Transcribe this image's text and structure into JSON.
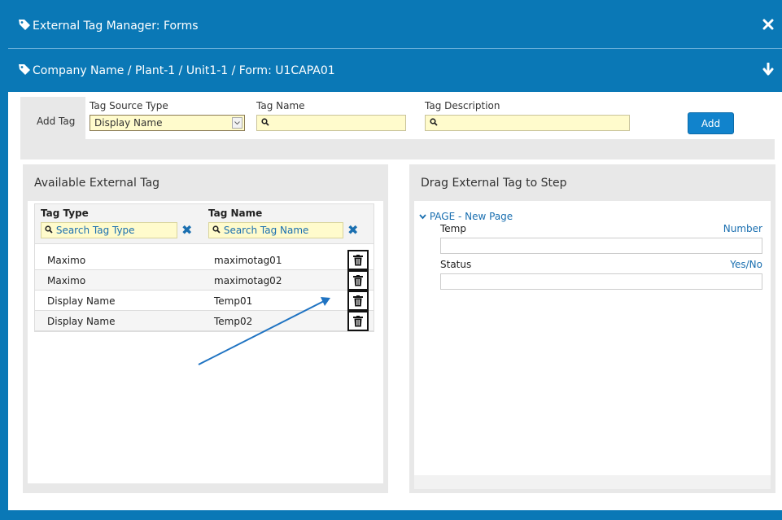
{
  "window": {
    "title": "External Tag Manager: Forms",
    "breadcrumb": "Company Name / Plant-1 / Unit1-1 / Form: U1CAPA01"
  },
  "add_tag": {
    "label": "Add Tag",
    "source_type_label": "Tag Source Type",
    "source_type_value": "Display Name",
    "tag_name_label": "Tag Name",
    "tag_name_value": "",
    "tag_description_label": "Tag Description",
    "tag_description_value": "",
    "add_button": "Add"
  },
  "available": {
    "title": "Available External Tag",
    "columns": [
      "Tag Type",
      "Tag Name"
    ],
    "filter_tag_type_placeholder": "Search Tag Type",
    "filter_tag_name_placeholder": "Search Tag Name",
    "rows": [
      {
        "type": "Maximo",
        "name": "maximotag01"
      },
      {
        "type": "Maximo",
        "name": "maximotag02"
      },
      {
        "type": "Display Name",
        "name": "Temp01"
      },
      {
        "type": "Display Name",
        "name": "Temp02"
      }
    ]
  },
  "drag": {
    "title": "Drag External Tag to Step",
    "page_label": "PAGE - New Page",
    "steps": [
      {
        "name": "Temp",
        "type": "Number",
        "value": ""
      },
      {
        "name": "Status",
        "type": "Yes/No",
        "value": ""
      }
    ]
  },
  "icons": {
    "title_tag": "tag-icon",
    "close": "close-icon",
    "collapse": "arrow-down-icon",
    "search": "search-icon",
    "clear": "clear-filter-icon",
    "delete": "trash-icon",
    "expand": "chevron-down-icon"
  },
  "colors": {
    "header_blue": "#0a78b6",
    "input_yellow": "#fffbcc",
    "link_blue": "#1a6fb0",
    "panel_gray": "#e8e8e8",
    "button_blue": "#1183cc"
  }
}
